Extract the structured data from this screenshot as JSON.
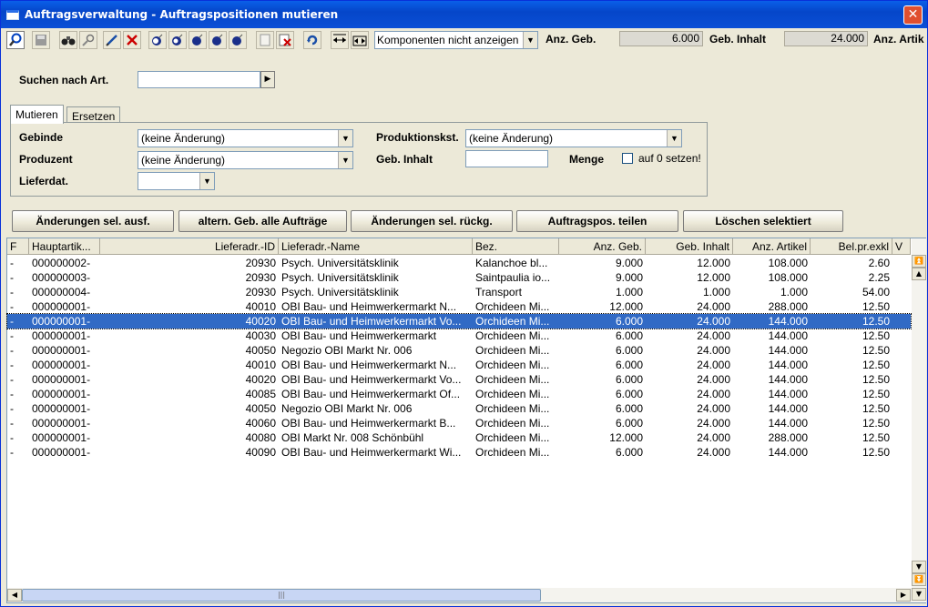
{
  "window": {
    "title": "Auftragsverwaltung - Auftragspositionen mutieren",
    "close_glyph": "✕"
  },
  "toolbar": {
    "icons": [
      "search-icon",
      "save-icon",
      "binoculars-icon",
      "key-search-icon",
      "edit-pen-icon",
      "delete-x-icon",
      "bomb-1-icon",
      "bomb-2-icon",
      "bomb-3-icon",
      "bomb-4-icon",
      "bomb-5-icon",
      "blank-doc-icon",
      "doc-delete-icon",
      "refresh-icon",
      "expand-width-icon",
      "collapse-width-icon"
    ],
    "component_select": "Komponenten nicht anzeigen",
    "anz_geb_label": "Anz. Geb.",
    "anz_geb_value": "6.000",
    "geb_inhalt_label": "Geb. Inhalt",
    "geb_inhalt_value": "24.000",
    "anz_artik_label": "Anz. Artik"
  },
  "search": {
    "label": "Suchen nach Art.",
    "value": "",
    "go": "▶"
  },
  "tabs": [
    {
      "label": "Mutieren"
    },
    {
      "label": "Ersetzen"
    }
  ],
  "form": {
    "gebinde_label": "Gebinde",
    "gebinde_value": "(keine Änderung)",
    "produzent_label": "Produzent",
    "produzent_value": "(keine Änderung)",
    "lieferdat_label": "Lieferdat.",
    "lieferdat_value": "",
    "produktionskst_label": "Produktionskst.",
    "produktionskst_value": "(keine Änderung)",
    "geb_inhalt_label": "Geb. Inhalt",
    "geb_inhalt_value": "",
    "menge_label": "Menge",
    "auf0_label": "auf 0 setzen!"
  },
  "actions": {
    "apply": "Änderungen sel. ausf.",
    "altern": "altern. Geb. alle Aufträge",
    "revert": "Änderungen sel. rückg.",
    "split": "Auftragspos. teilen",
    "delete": "Löschen selektiert"
  },
  "grid": {
    "headers": [
      "F",
      "Hauptartik...",
      "Lieferadr.-ID",
      "Lieferadr.-Name",
      "Bez.",
      "Anz. Geb.",
      "Geb. Inhalt",
      "Anz. Artikel",
      "Bel.pr.exkl",
      "V"
    ],
    "rows": [
      [
        "-",
        "000000002-",
        "20930",
        "Psych. Universitätsklinik",
        "Kalanchoe bl...",
        "9.000",
        "12.000",
        "108.000",
        "2.60"
      ],
      [
        "-",
        "000000003-",
        "20930",
        "Psych. Universitätsklinik",
        "Saintpaulia io...",
        "9.000",
        "12.000",
        "108.000",
        "2.25"
      ],
      [
        "-",
        "000000004-",
        "20930",
        "Psych. Universitätsklinik",
        "Transport",
        "1.000",
        "1.000",
        "1.000",
        "54.00"
      ],
      [
        "-",
        "000000001-",
        "40010",
        "OBI Bau- und Heimwerkermarkt N...",
        "Orchideen Mi...",
        "12.000",
        "24.000",
        "288.000",
        "12.50"
      ],
      [
        "-",
        "000000001-",
        "40020",
        "OBI Bau- und Heimwerkermarkt Vo...",
        "Orchideen Mi...",
        "6.000",
        "24.000",
        "144.000",
        "12.50"
      ],
      [
        "-",
        "000000001-",
        "40030",
        "OBI Bau- und Heimwerkermarkt",
        "Orchideen Mi...",
        "6.000",
        "24.000",
        "144.000",
        "12.50"
      ],
      [
        "-",
        "000000001-",
        "40050",
        "Negozio OBI Markt Nr. 006",
        "Orchideen Mi...",
        "6.000",
        "24.000",
        "144.000",
        "12.50"
      ],
      [
        "-",
        "000000001-",
        "40010",
        "OBI Bau- und Heimwerkermarkt N...",
        "Orchideen Mi...",
        "6.000",
        "24.000",
        "144.000",
        "12.50"
      ],
      [
        "-",
        "000000001-",
        "40020",
        "OBI Bau- und Heimwerkermarkt Vo...",
        "Orchideen Mi...",
        "6.000",
        "24.000",
        "144.000",
        "12.50"
      ],
      [
        "-",
        "000000001-",
        "40085",
        "OBI Bau- und Heimwerkermarkt Of...",
        "Orchideen Mi...",
        "6.000",
        "24.000",
        "144.000",
        "12.50"
      ],
      [
        "-",
        "000000001-",
        "40050",
        "Negozio OBI Markt Nr. 006",
        "Orchideen Mi...",
        "6.000",
        "24.000",
        "144.000",
        "12.50"
      ],
      [
        "-",
        "000000001-",
        "40060",
        "OBI Bau- und Heimwerkermarkt B...",
        "Orchideen Mi...",
        "6.000",
        "24.000",
        "144.000",
        "12.50"
      ],
      [
        "-",
        "000000001-",
        "40080",
        "OBI Markt Nr. 008 Schönbühl",
        "Orchideen Mi...",
        "12.000",
        "24.000",
        "288.000",
        "12.50"
      ],
      [
        "-",
        "000000001-",
        "40090",
        "OBI Bau- und Heimwerkermarkt Wi...",
        "Orchideen Mi...",
        "6.000",
        "24.000",
        "144.000",
        "12.50"
      ]
    ],
    "selected_row": 4
  }
}
